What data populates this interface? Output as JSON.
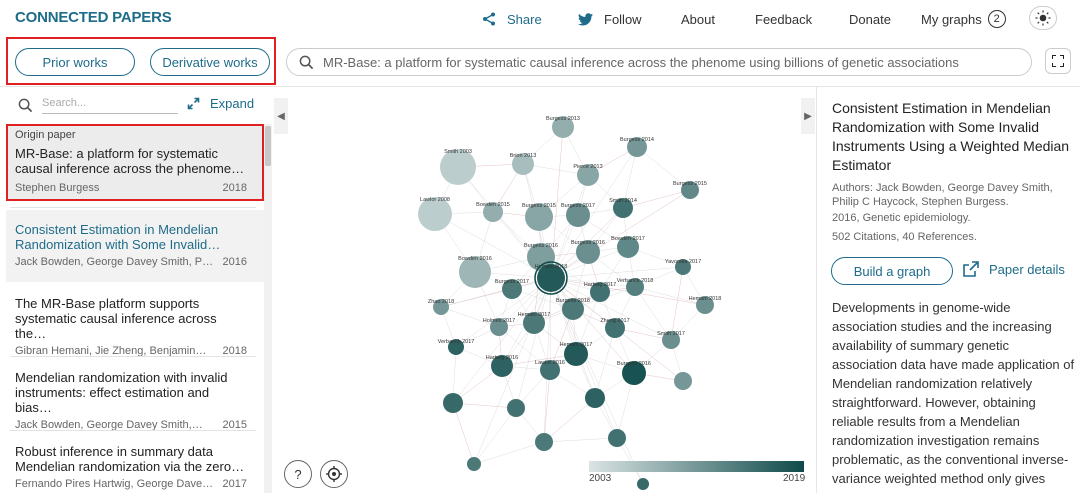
{
  "header": {
    "logo": "CONNECTED PAPERS",
    "nav": {
      "share": "Share",
      "follow": "Follow",
      "about": "About",
      "feedback": "Feedback",
      "donate": "Donate",
      "my_graphs": "My graphs",
      "my_graphs_count": "2"
    }
  },
  "toolbar": {
    "prior_works": "Prior works",
    "derivative_works": "Derivative works",
    "search_value": "MR-Base: a platform for systematic causal inference across the phenome using billions of genetic associations"
  },
  "left_panel": {
    "search_placeholder": "Search...",
    "expand_label": "Expand",
    "origin_label": "Origin paper",
    "papers": [
      {
        "title": "MR-Base: a platform for systematic causal inference across the phenome…",
        "authors": "Stephen Burgess",
        "year": "2018"
      },
      {
        "title": "Consistent Estimation in Mendelian Randomization with Some Invalid…",
        "authors": "Jack Bowden, George Davey Smith, Philip …",
        "year": "2016"
      },
      {
        "title": "The MR-Base platform supports systematic causal inference across the…",
        "authors": "Gibran Hemani, Jie Zheng, Benjamin…",
        "year": "2018"
      },
      {
        "title": "Mendelian randomization with invalid instruments: effect estimation and bias…",
        "authors": "Jack Bowden, George Davey Smith,…",
        "year": "2015"
      },
      {
        "title": "Robust inference in summary data Mendelian randomization via the zero…",
        "authors": "Fernando Pires Hartwig, George Davey…",
        "year": "2017"
      }
    ]
  },
  "graph": {
    "help_icon_label": "?",
    "legend": {
      "start": "2003",
      "end": "2019",
      "color_start": "#dbe4e4",
      "color_end": "#0f4a4a"
    },
    "nodes": [
      {
        "label": "Burgess 2013"
      },
      {
        "label": "Burgess 2014"
      },
      {
        "label": "Smith 2003"
      },
      {
        "label": "Brion 2013"
      },
      {
        "label": "Pierce 2013"
      },
      {
        "label": "Burgess 2015"
      },
      {
        "label": "Lawlor 2008"
      },
      {
        "label": "Bowden 2015"
      },
      {
        "label": "Burgess 2015"
      },
      {
        "label": "Burgess 2017"
      },
      {
        "label": "Smith 2014"
      },
      {
        "label": "Bowden 2016"
      },
      {
        "label": "Burgess 2016"
      },
      {
        "label": "Burgess 2016"
      },
      {
        "label": "Bowden 2017"
      },
      {
        "label": "Hemani 2018"
      },
      {
        "label": "Burgess 2017"
      },
      {
        "label": "Hartwig 2017"
      },
      {
        "label": "Verbanck 2018"
      },
      {
        "label": "Yavorska 2017"
      },
      {
        "label": "Zhao 2018"
      },
      {
        "label": "Burgess 2018"
      },
      {
        "label": "Holmes 2017"
      },
      {
        "label": "Hemani 2017"
      },
      {
        "label": "Zheng 2017"
      },
      {
        "label": "Hemani 2018"
      },
      {
        "label": "Verbanck 2017"
      },
      {
        "label": "Hemani 2017"
      },
      {
        "label": "Hartwig 2016"
      },
      {
        "label": "Lawlor 2016"
      },
      {
        "label": "Burgess 2016"
      },
      {
        "label": "Smith 2017"
      }
    ]
  },
  "right_panel": {
    "title": "Consistent Estimation in Mendelian Randomization with Some Invalid Instruments Using a Weighted Median Estimator",
    "authors": "Authors: Jack Bowden, George Davey Smith, Philip C Haycock, Stephen Burgess.",
    "year_venue": "2016, Genetic epidemiology.",
    "citations": "502 Citations, 40 References.",
    "build_graph": "Build a graph",
    "paper_details": "Paper details",
    "abstract": "Developments in genome-wide association studies and the increasing availability of summary genetic association data have made application of Mendelian randomization relatively straightforward. However, obtaining reliable results from a Mendelian randomization investigation remains problematic, as the conventional inverse-variance weighted method only gives"
  },
  "colors": {
    "accent": "#1e6c8a",
    "highlight_box": "#e02020"
  }
}
